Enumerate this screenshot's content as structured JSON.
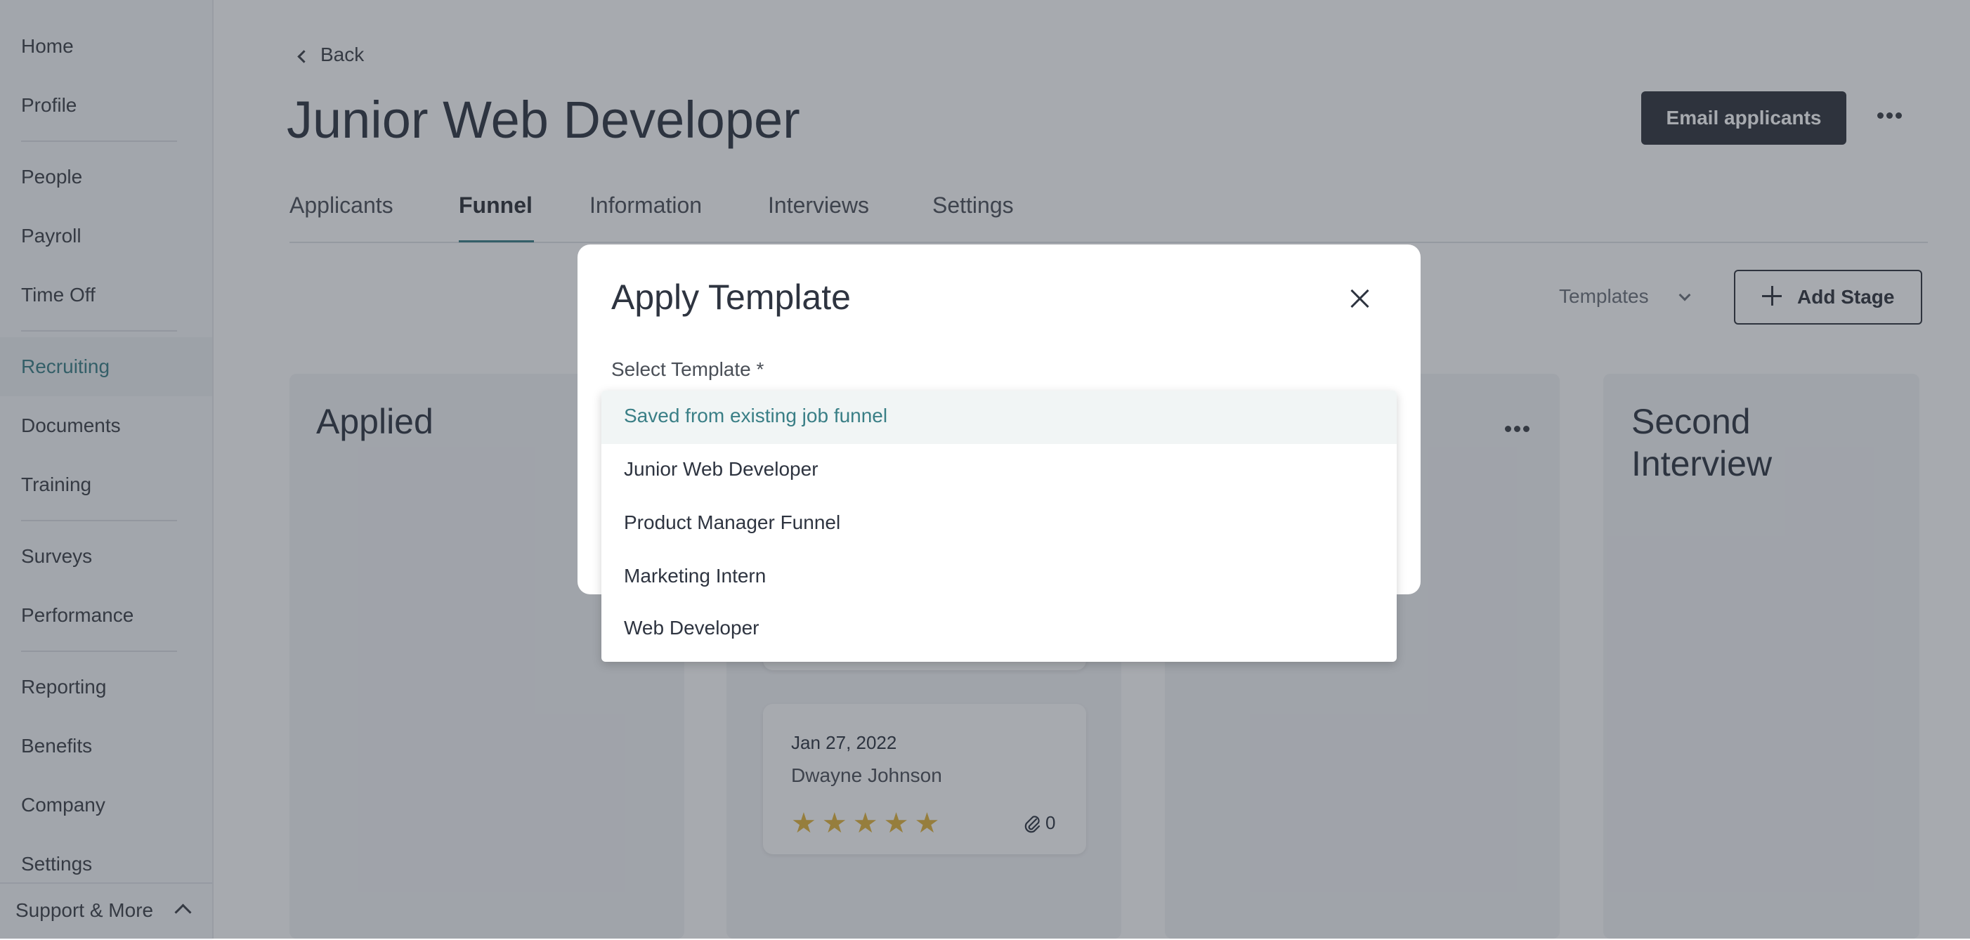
{
  "sidebar": {
    "items": [
      "Home",
      "Profile",
      "People",
      "Payroll",
      "Time Off",
      "Recruiting",
      "Documents",
      "Training",
      "Surveys",
      "Performance",
      "Reporting",
      "Benefits",
      "Company",
      "Settings"
    ],
    "active_item": "Recruiting",
    "support_label": "Support & More"
  },
  "header": {
    "back_label": "Back",
    "title": "Junior Web Developer",
    "email_button": "Email applicants",
    "more_icon": "ellipsis-icon"
  },
  "tabs": {
    "items": [
      "Applicants",
      "Funnel",
      "Information",
      "Interviews",
      "Settings"
    ],
    "active": "Funnel"
  },
  "toolbar": {
    "templates_label": "Templates",
    "add_stage_label": "Add Stage"
  },
  "columns": [
    {
      "title": "Applied"
    },
    {
      "title": ""
    },
    {
      "title": ""
    },
    {
      "title": "Second Interview"
    }
  ],
  "card": {
    "date": "Jan 27, 2022",
    "name": "Dwayne Johnson",
    "rating": 5,
    "rating_max": 5,
    "attachments": "0"
  },
  "modal": {
    "title": "Apply Template",
    "field_label": "Select Template *",
    "options": [
      "Saved from existing job funnel",
      "Junior Web Developer",
      "Product Manager Funnel",
      "Marketing Intern",
      "Web Developer"
    ],
    "highlighted_option": "Saved from existing job funnel"
  },
  "colors": {
    "accent": "#3a7f86",
    "star": "#e2b33c",
    "dark_button": "#2f333b"
  }
}
